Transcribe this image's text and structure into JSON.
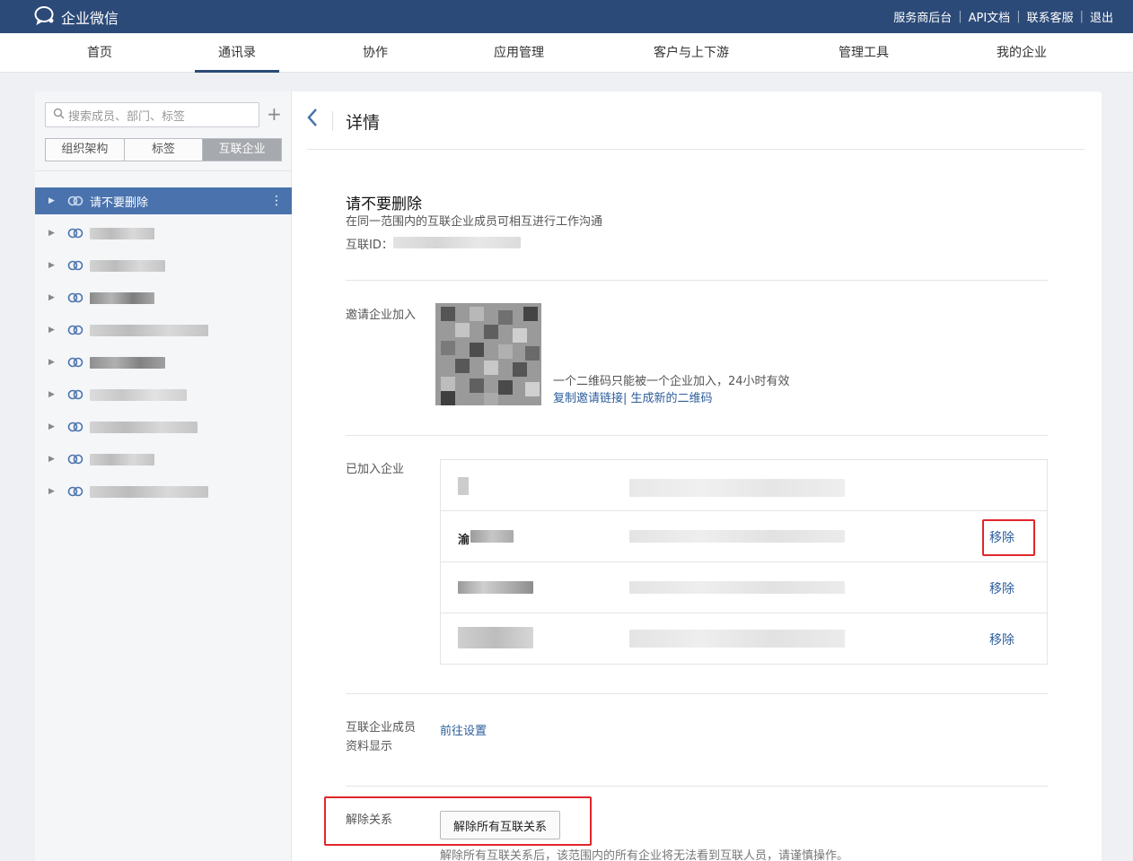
{
  "app": {
    "title": "企业微信"
  },
  "top_links": [
    "服务商后台",
    "API文档",
    "联系客服",
    "退出"
  ],
  "nav": {
    "items": [
      "首页",
      "通讯录",
      "协作",
      "应用管理",
      "客户与上下游",
      "管理工具",
      "我的企业"
    ],
    "active": "通讯录"
  },
  "sidebar": {
    "search_placeholder": "搜索成员、部门、标签",
    "tabs": [
      "组织架构",
      "标签",
      "互联企业"
    ],
    "active_tab": "互联企业",
    "selected_item": "请不要删除"
  },
  "main": {
    "title": "详情",
    "corp": {
      "name": "请不要删除",
      "description": "在同一范围内的互联企业成员可相互进行工作沟通",
      "id_label": "互联ID："
    },
    "invite": {
      "label": "邀请企业加入",
      "note": "一个二维码只能被一个企业加入，24小时有效",
      "copy_link": "复制邀请链接",
      "link_sep": "|",
      "new_qr": "生成新的二维码"
    },
    "joined": {
      "label": "已加入企业",
      "rows": [
        {
          "name": "",
          "action": ""
        },
        {
          "name": "渝",
          "action": "移除"
        },
        {
          "name": "",
          "action": "移除"
        },
        {
          "name": "",
          "action": "移除"
        }
      ]
    },
    "member_display": {
      "label_line1": "互联企业成员",
      "label_line2": "资料显示",
      "link": "前往设置"
    },
    "unlink": {
      "label": "解除关系",
      "button": "解除所有互联关系",
      "warning": "解除所有互联关系后，该范围内的所有企业将无法看到互联人员，请谨慎操作。"
    }
  },
  "colors": {
    "topbar": "#2c4a78",
    "selected_item": "#4a73ae",
    "link": "#2c5d9b",
    "highlight": "#e0262b"
  }
}
